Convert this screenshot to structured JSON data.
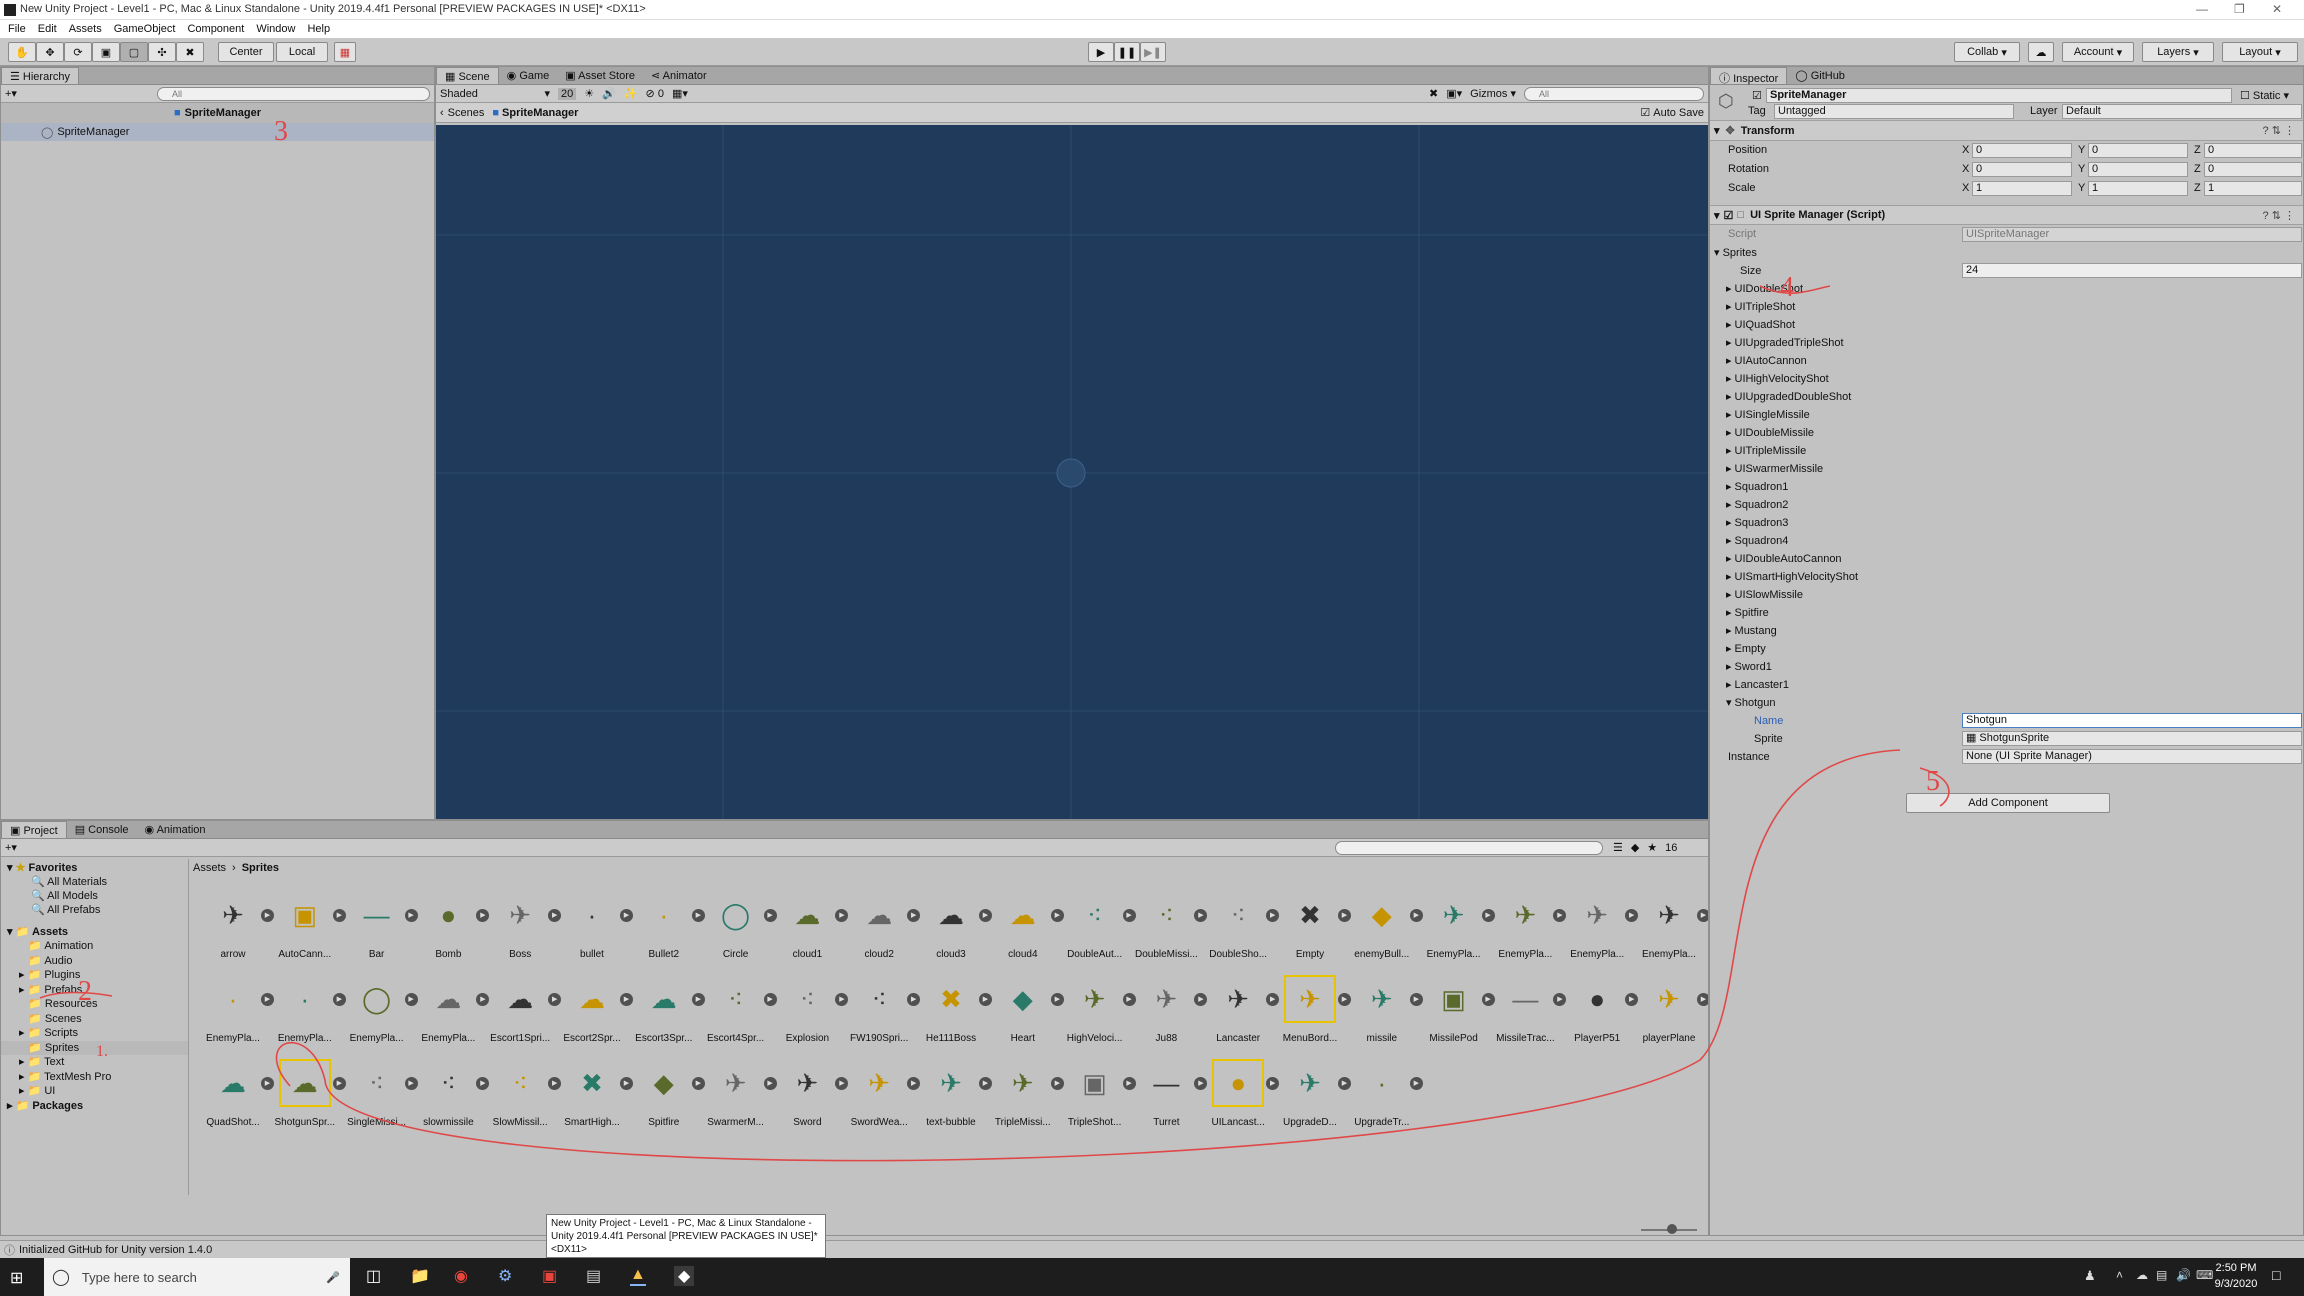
{
  "title_bar": {
    "title": "New Unity Project - Level1 - PC, Mac & Linux Standalone - Unity 2019.4.4f1 Personal [PREVIEW PACKAGES IN USE]* <DX11>"
  },
  "menu": [
    "File",
    "Edit",
    "Assets",
    "GameObject",
    "Component",
    "Window",
    "Help"
  ],
  "toolbar": {
    "pivot": "Center",
    "space": "Local",
    "collab": "Collab",
    "account": "Account",
    "layers": "Layers",
    "layout": "Layout"
  },
  "hierarchy": {
    "tab": "Hierarchy",
    "search_placeholder": "All",
    "scene_root": "SpriteManager",
    "item": "SpriteManager"
  },
  "scene": {
    "tabs": [
      "Scene",
      "Game",
      "Asset Store",
      "Animator"
    ],
    "shading": "Shaded",
    "dim": "20",
    "layer_count": "0",
    "gizmos": "Gizmos",
    "search_placeholder": "All",
    "breadcrumb": [
      "Scenes",
      "SpriteManager"
    ],
    "auto_save": "Auto Save"
  },
  "inspector": {
    "tabs": [
      "Inspector",
      "GitHub"
    ],
    "object_name": "SpriteManager",
    "static_label": "Static",
    "tag_label": "Tag",
    "tag": "Untagged",
    "layer_label": "Layer",
    "layer": "Default",
    "transform": {
      "title": "Transform",
      "position": {
        "label": "Position",
        "x": "0",
        "y": "0",
        "z": "0"
      },
      "rotation": {
        "label": "Rotation",
        "x": "0",
        "y": "0",
        "z": "0"
      },
      "scale": {
        "label": "Scale",
        "x": "1",
        "y": "1",
        "z": "1"
      }
    },
    "script_component": {
      "title": "UI Sprite Manager (Script)",
      "script_label": "Script",
      "script_value": "UISpriteManager",
      "sprites_label": "Sprites",
      "size_label": "Size",
      "size": "24",
      "elements": [
        "UIDoubleShot",
        "UITripleShot",
        "UIQuadShot",
        "UIUpgradedTripleShot",
        "UIAutoCannon",
        "UIHighVelocityShot",
        "UIUpgradedDoubleShot",
        "UISingleMissile",
        "UIDoubleMissile",
        "UITripleMissile",
        "UISwarmerMissile",
        "Squadron1",
        "Squadron2",
        "Squadron3",
        "Squadron4",
        "UIDoubleAutoCannon",
        "UISmartHighVelocityShot",
        "UISlowMissile",
        "Spitfire",
        "Mustang",
        "Empty",
        "Sword1",
        "Lancaster1",
        "Shotgun"
      ],
      "shotgun_name_label": "Name",
      "shotgun_name": "Shotgun",
      "shotgun_sprite_label": "Sprite",
      "shotgun_sprite": "ShotgunSprite",
      "instance_label": "Instance",
      "instance_value": "None (UI Sprite Manager)"
    },
    "add_component": "Add Component"
  },
  "project": {
    "tabs": [
      "Project",
      "Console",
      "Animation"
    ],
    "count": "16",
    "favorites": {
      "label": "Favorites",
      "items": [
        "All Materials",
        "All Models",
        "All Prefabs"
      ]
    },
    "assets_label": "Assets",
    "folders": [
      "Animation",
      "Audio",
      "Plugins",
      "Prefabs",
      "Resources",
      "Scenes",
      "Scripts",
      "Sprites",
      "Text",
      "TextMesh Pro",
      "UI"
    ],
    "packages_label": "Packages",
    "breadcrumb": [
      "Assets",
      "Sprites"
    ],
    "sprites": [
      [
        "arrow",
        "AutoCann...",
        "Bar",
        "Bomb",
        "Boss",
        "bullet",
        "Bullet2",
        "Circle",
        "cloud1",
        "cloud2",
        "cloud3",
        "cloud4",
        "DoubleAut...",
        "DoubleMissi...",
        "DoubleSho...",
        "Empty",
        "enemyBull...",
        "EnemyPla...",
        "EnemyPla...",
        "EnemyPla...",
        "EnemyPla..."
      ],
      [
        "EnemyPla...",
        "EnemyPla...",
        "EnemyPla...",
        "EnemyPla...",
        "Escort1Spri...",
        "Escort2Spr...",
        "Escort3Spr...",
        "Escort4Spr...",
        "Explosion",
        "FW190Spri...",
        "He111Boss",
        "Heart",
        "HighVeloci...",
        "Ju88",
        "Lancaster",
        "MenuBord...",
        "missile",
        "MissilePod",
        "MissileTrac...",
        "PlayerP51",
        "playerPlane"
      ],
      [
        "QuadShot...",
        "ShotgunSpr...",
        "SingleMissi...",
        "slowmissile",
        "SlowMissil...",
        "SmartHigh...",
        "Spitfire",
        "SwarmerM...",
        "Sword",
        "SwordWea...",
        "text-bubble",
        "TripleMissi...",
        "TripleShot...",
        "Turret",
        "UILancast...",
        "UpgradeD...",
        "UpgradeTr..."
      ]
    ]
  },
  "status_bar": {
    "text": "Initialized GitHub for Unity version 1.4.0"
  },
  "tooltip": {
    "text": "New Unity Project - Level1 - PC, Mac & Linux Standalone - Unity 2019.4.4f1 Personal [PREVIEW PACKAGES IN USE]* <DX11>"
  },
  "taskbar": {
    "search_placeholder": "Type here to search",
    "time": "2:50 PM",
    "date": "9/3/2020"
  },
  "annotations": [
    "3",
    "4",
    "2",
    "1.",
    "5"
  ],
  "colors": {
    "scene_bg": "#1e3a5c",
    "annotation": "#e04848",
    "taskbar": "#1d1d1d"
  }
}
